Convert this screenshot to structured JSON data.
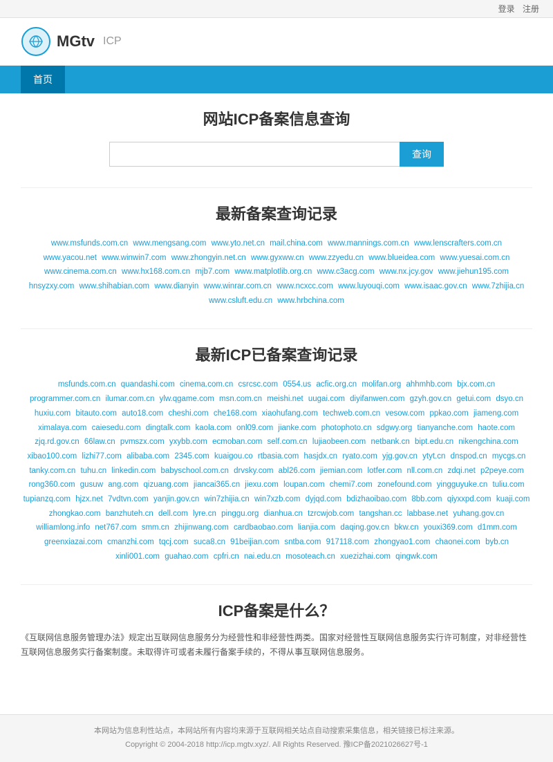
{
  "topbar": {
    "login": "登录",
    "register": "注册"
  },
  "header": {
    "logo_alt": "MGtv ICP",
    "brand": "MGtv",
    "icp": "ICP"
  },
  "nav": {
    "items": [
      {
        "label": "首页",
        "active": true
      }
    ]
  },
  "search_section": {
    "title": "网站ICP备案信息查询",
    "input_placeholder": "",
    "button_label": "查询"
  },
  "recent_query": {
    "title": "最新备案查询记录",
    "links": [
      "www.msfunds.com.cn",
      "www.mengsang.com",
      "www.yto.net.cn",
      "mail.china.com",
      "www.mannings.com.cn",
      "www.lenscrafters.com.cn",
      "www.yacou.net",
      "www.winwin7.com",
      "www.zhongyin.net.cn",
      "www.gyxww.cn",
      "www.zzyedu.cn",
      "www.blueidea.com",
      "www.yuesai.com.cn",
      "www.cinema.com.cn",
      "www.hx168.com.cn",
      "mjb7.com",
      "www.matplotlib.org.cn",
      "www.c3acg.com",
      "www.nx.jcy.gov",
      "www.jiehun195.com",
      "hnsyzxy.com",
      "www.shihabian.com",
      "www.dianyin",
      "www.winrar.com.cn",
      "www.ncxcc.com",
      "www.luyouqi.com",
      "www.isaac.gov.cn",
      "www.7zhijia.cn",
      "www.csluft.edu.cn",
      "www.hrbchina.com"
    ]
  },
  "icp_query": {
    "title": "最新ICP已备案查询记录",
    "links": [
      "msfunds.com.cn",
      "quandashi.com",
      "cinema.com.cn",
      "csrcsc.com",
      "0554.us",
      "acfic.org.cn",
      "molifan.org",
      "ahhmhb.com",
      "bjx.com.cn",
      "programmer.com.cn",
      "ilumar.com.cn",
      "ylw.qgame.com",
      "msn.com.cn",
      "meishi.net",
      "uugai.com",
      "diyifanwen.com",
      "gzyh.gov.cn",
      "getui.com",
      "dsyo.cn",
      "huxiu.com",
      "bitauto.com",
      "auto18.com",
      "cheshi.com",
      "che168.com",
      "xiaohufang.com",
      "techweb.com.cn",
      "vesow.com",
      "ppkao.com",
      "jiameng.com",
      "ximalaya.com",
      "caiesedu.com",
      "dingtalk.com",
      "kaola.com",
      "onl09.com",
      "jianke.com",
      "photophoto.cn",
      "sdgwy.org",
      "tianyanche.com",
      "haote.com",
      "zjq.rd.gov.cn",
      "66law.cn",
      "pvmszx.com",
      "yxybb.com",
      "ecmoban.com",
      "self.com.cn",
      "lujiaobeen.com",
      "netbank.cn",
      "bipt.edu.cn",
      "nikengchina.com",
      "xibao100.com",
      "lizhi77.com",
      "alibaba.com",
      "2345.com",
      "kuaigou.co",
      "rtbasia.com",
      "hasjdx.cn",
      "ryato.com",
      "yjg.gov.cn",
      "ytyt.cn",
      "dnspod.cn",
      "mycgs.cn",
      "tanky.com.cn",
      "tuhu.cn",
      "linkedin.com",
      "babyschool.com.cn",
      "drvsky.com",
      "abl26.com",
      "jiemian.com",
      "lotfer.com",
      "nll.com.cn",
      "zdqi.net",
      "p2peye.com",
      "rong360.com",
      "gusuw",
      "ang.com",
      "qizuang.com",
      "jiancai365.cn",
      "jiexu.com",
      "loupan.com",
      "chemi7.com",
      "zonefound.com",
      "yingguyuke.cn",
      "tuliu.com",
      "tupianzq.com",
      "hjzx.net",
      "7vdtvn.com",
      "yanjin.gov.cn",
      "win7zhijia.cn",
      "win7xzb.com",
      "dyjqd.com",
      "bdizhaoibao.com",
      "8bb.com",
      "qiyxxpd.com",
      "kuaji.com",
      "zhongkao.com",
      "banzhuteh.cn",
      "dell.com",
      "lyre.cn",
      "pinggu.org",
      "dianhua.cn",
      "tzrcwjob.com",
      "tangshan.cc",
      "labbase.net",
      "yuhang.gov.cn",
      "williamlong.info",
      "net767.com",
      "smm.cn",
      "zhijinwang.com",
      "cardbaobao.com",
      "lianjia.com",
      "daqing.gov.cn",
      "bkw.cn",
      "youxi369.com",
      "d1mm.com",
      "greenxiazai.com",
      "cmanzhi.com",
      "tqcj.com",
      "suca8.cn",
      "91beijian.com",
      "sntba.com",
      "917118.com",
      "zhongyao1.com",
      "chaonei.com",
      "byb.cn",
      "xinli001.com",
      "guahao.com",
      "cpfri.cn",
      "nai.edu.cn",
      "mosoteach.cn",
      "xuezizhai.com",
      "qingwk.com"
    ]
  },
  "icp_what": {
    "title": "ICP备案是什么？",
    "text": "《互联网信息服务管理办法》规定出互联网信息服务分为经营性和非经营性两类。国家对经营性互联网信息服务实行许可制度，对非经营性互联网信息服务实行备案制度。未取得许可或者未履行备案手续的，不得从事互联网信息服务。"
  },
  "footer": {
    "disclaimer": "本网站为信息利性站点，本网站所有内容均来源于互联网相关站点自动搜索采集信息，相关链接已标注来源。",
    "copyright": "Copyright © 2004-2018 http://icp.mgtv.xyz/. All Rights Reserved. 豫ICP备2021026627号-1"
  }
}
